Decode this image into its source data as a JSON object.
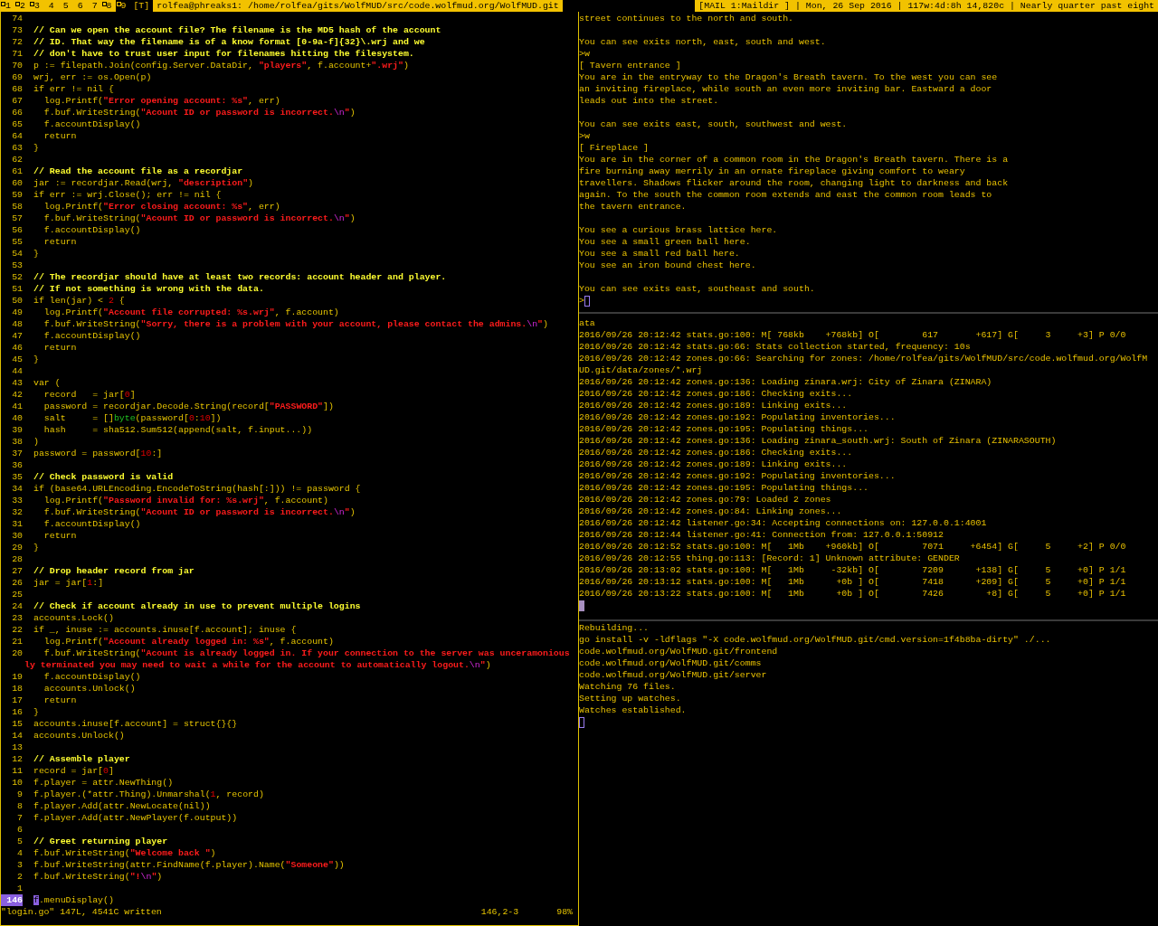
{
  "bar": {
    "tags": [
      {
        "label": "1",
        "occupied": true,
        "selected": false
      },
      {
        "label": "2",
        "occupied": true,
        "selected": false
      },
      {
        "label": "3",
        "occupied": true,
        "selected": false
      },
      {
        "label": "4",
        "occupied": false,
        "selected": false
      },
      {
        "label": "5",
        "occupied": false,
        "selected": false
      },
      {
        "label": "6",
        "occupied": false,
        "selected": false
      },
      {
        "label": "7",
        "occupied": false,
        "selected": false
      },
      {
        "label": "8",
        "occupied": true,
        "selected": false
      },
      {
        "label": "9",
        "occupied": true,
        "selected": true
      }
    ],
    "layout": "[T]",
    "title": "rolfea@phreaks1: /home/rolfea/gits/WolfMUD/src/code.wolfmud.org/WolfMUD.git",
    "status": "[MAIL 1:Maildir ] | Mon, 26 Sep 2016 | 117w:4d:8h 14,820c | Nearly quarter past eight"
  },
  "editor": {
    "lines": [
      {
        "number": "74",
        "current": false
      },
      {
        "number": "73",
        "current": false,
        "segments": [
          {
            "kind": "comment",
            "text": "// Can we open the account file? The filename is the MD5 hash of the account"
          }
        ]
      },
      {
        "number": "72",
        "current": false,
        "segments": [
          {
            "kind": "comment",
            "text": "// ID. That way the filename is of a know format [0-9a-f]{32}\\.wrj and we"
          }
        ]
      },
      {
        "number": "71",
        "current": false,
        "segments": [
          {
            "kind": "comment",
            "text": "// don't have to trust user input for filenames hitting the filesystem."
          }
        ]
      },
      {
        "number": "70",
        "current": false,
        "segments": [
          {
            "kind": "code",
            "text": "p := filepath.Join(config.Server.DataDir, "
          },
          {
            "kind": "string",
            "text": "\"players\""
          },
          {
            "kind": "code",
            "text": ", f.account+"
          },
          {
            "kind": "string",
            "text": "\".wrj\""
          },
          {
            "kind": "code",
            "text": ")"
          }
        ]
      },
      {
        "number": "69",
        "current": false,
        "segments": [
          {
            "kind": "code",
            "text": "wrj, err := os.Open(p)"
          }
        ]
      },
      {
        "number": "68",
        "current": false,
        "segments": [
          {
            "kind": "code",
            "text": "if err != nil {"
          }
        ]
      },
      {
        "number": "67",
        "current": false,
        "segments": [
          {
            "kind": "code",
            "text": "  log.Printf("
          },
          {
            "kind": "string",
            "text": "\"Error opening account: %s\""
          },
          {
            "kind": "code",
            "text": ", err)"
          }
        ]
      },
      {
        "number": "66",
        "current": false,
        "segments": [
          {
            "kind": "code",
            "text": "  f.buf.WriteString("
          },
          {
            "kind": "string",
            "text": "\"Acount ID or password is incorrect."
          },
          {
            "kind": "escape",
            "text": "\\n"
          },
          {
            "kind": "string",
            "text": "\""
          },
          {
            "kind": "code",
            "text": ")"
          }
        ]
      },
      {
        "number": "65",
        "current": false,
        "segments": [
          {
            "kind": "code",
            "text": "  f.accountDisplay()"
          }
        ]
      },
      {
        "number": "64",
        "current": false,
        "segments": [
          {
            "kind": "code",
            "text": "  return"
          }
        ]
      },
      {
        "number": "63",
        "current": false,
        "segments": [
          {
            "kind": "code",
            "text": "}"
          }
        ]
      },
      {
        "number": "62",
        "current": false
      },
      {
        "number": "61",
        "current": false,
        "segments": [
          {
            "kind": "comment",
            "text": "// Read the account file as a recordjar"
          }
        ]
      },
      {
        "number": "60",
        "current": false,
        "segments": [
          {
            "kind": "code",
            "text": "jar := recordjar.Read(wrj, "
          },
          {
            "kind": "string",
            "text": "\"description\""
          },
          {
            "kind": "code",
            "text": ")"
          }
        ]
      },
      {
        "number": "59",
        "current": false,
        "segments": [
          {
            "kind": "code",
            "text": "if err := wrj.Close(); err != nil {"
          }
        ]
      },
      {
        "number": "58",
        "current": false,
        "segments": [
          {
            "kind": "code",
            "text": "  log.Printf("
          },
          {
            "kind": "string",
            "text": "\"Error closing account: %s\""
          },
          {
            "kind": "code",
            "text": ", err)"
          }
        ]
      },
      {
        "number": "57",
        "current": false,
        "segments": [
          {
            "kind": "code",
            "text": "  f.buf.WriteString("
          },
          {
            "kind": "string",
            "text": "\"Acount ID or password is incorrect."
          },
          {
            "kind": "escape",
            "text": "\\n"
          },
          {
            "kind": "string",
            "text": "\""
          },
          {
            "kind": "code",
            "text": ")"
          }
        ]
      },
      {
        "number": "56",
        "current": false,
        "segments": [
          {
            "kind": "code",
            "text": "  f.accountDisplay()"
          }
        ]
      },
      {
        "number": "55",
        "current": false,
        "segments": [
          {
            "kind": "code",
            "text": "  return"
          }
        ]
      },
      {
        "number": "54",
        "current": false,
        "segments": [
          {
            "kind": "code",
            "text": "}"
          }
        ]
      },
      {
        "number": "53",
        "current": false
      },
      {
        "number": "52",
        "current": false,
        "segments": [
          {
            "kind": "comment",
            "text": "// The recordjar should have at least two records: account header and player."
          }
        ]
      },
      {
        "number": "51",
        "current": false,
        "segments": [
          {
            "kind": "comment",
            "text": "// If not something is wrong with the data."
          }
        ]
      },
      {
        "number": "50",
        "current": false,
        "segments": [
          {
            "kind": "code",
            "text": "if len(jar) < "
          },
          {
            "kind": "number",
            "text": "2"
          },
          {
            "kind": "code",
            "text": " {"
          }
        ]
      },
      {
        "number": "49",
        "current": false,
        "segments": [
          {
            "kind": "code",
            "text": "  log.Printf("
          },
          {
            "kind": "string",
            "text": "\"Account file corrupted: %s.wrj\""
          },
          {
            "kind": "code",
            "text": ", f.account)"
          }
        ]
      },
      {
        "number": "48",
        "current": false,
        "segments": [
          {
            "kind": "code",
            "text": "  f.buf.WriteString("
          },
          {
            "kind": "string",
            "text": "\"Sorry, there is a problem with your account, please contact the admins."
          },
          {
            "kind": "escape",
            "text": "\\n"
          },
          {
            "kind": "string",
            "text": "\""
          },
          {
            "kind": "code",
            "text": ")"
          }
        ]
      },
      {
        "number": "47",
        "current": false,
        "segments": [
          {
            "kind": "code",
            "text": "  f.accountDisplay()"
          }
        ]
      },
      {
        "number": "46",
        "current": false,
        "segments": [
          {
            "kind": "code",
            "text": "  return"
          }
        ]
      },
      {
        "number": "45",
        "current": false,
        "segments": [
          {
            "kind": "code",
            "text": "}"
          }
        ]
      },
      {
        "number": "44",
        "current": false
      },
      {
        "number": "43",
        "current": false,
        "segments": [
          {
            "kind": "code",
            "text": "var ("
          }
        ]
      },
      {
        "number": "42",
        "current": false,
        "segments": [
          {
            "kind": "code",
            "text": "  record   = jar["
          },
          {
            "kind": "number",
            "text": "0"
          },
          {
            "kind": "code",
            "text": "]"
          }
        ]
      },
      {
        "number": "41",
        "current": false,
        "segments": [
          {
            "kind": "code",
            "text": "  password = recordjar.Decode.String(record["
          },
          {
            "kind": "string",
            "text": "\"PASSWORD\""
          },
          {
            "kind": "code",
            "text": "])"
          }
        ]
      },
      {
        "number": "40",
        "current": false,
        "segments": [
          {
            "kind": "code",
            "text": "  salt     = []"
          },
          {
            "kind": "type",
            "text": "byte"
          },
          {
            "kind": "code",
            "text": "(password["
          },
          {
            "kind": "number",
            "text": "0"
          },
          {
            "kind": "code",
            "text": ":"
          },
          {
            "kind": "number",
            "text": "10"
          },
          {
            "kind": "code",
            "text": "])"
          }
        ]
      },
      {
        "number": "39",
        "current": false,
        "segments": [
          {
            "kind": "code",
            "text": "  hash     = sha512.Sum512(append(salt, f.input...))"
          }
        ]
      },
      {
        "number": "38",
        "current": false,
        "segments": [
          {
            "kind": "code",
            "text": ")"
          }
        ]
      },
      {
        "number": "37",
        "current": false,
        "segments": [
          {
            "kind": "code",
            "text": "password = password["
          },
          {
            "kind": "number",
            "text": "10"
          },
          {
            "kind": "code",
            "text": ":]"
          }
        ]
      },
      {
        "number": "36",
        "current": false
      },
      {
        "number": "35",
        "current": false,
        "segments": [
          {
            "kind": "comment",
            "text": "// Check password is valid"
          }
        ]
      },
      {
        "number": "34",
        "current": false,
        "segments": [
          {
            "kind": "code",
            "text": "if (base64.URLEncoding.EncodeToString(hash[:])) != password {"
          }
        ]
      },
      {
        "number": "33",
        "current": false,
        "segments": [
          {
            "kind": "code",
            "text": "  log.Printf("
          },
          {
            "kind": "string",
            "text": "\"Password invalid for: %s.wrj\""
          },
          {
            "kind": "code",
            "text": ", f.account)"
          }
        ]
      },
      {
        "number": "32",
        "current": false,
        "segments": [
          {
            "kind": "code",
            "text": "  f.buf.WriteString("
          },
          {
            "kind": "string",
            "text": "\"Acount ID or password is incorrect."
          },
          {
            "kind": "escape",
            "text": "\\n"
          },
          {
            "kind": "string",
            "text": "\""
          },
          {
            "kind": "code",
            "text": ")"
          }
        ]
      },
      {
        "number": "31",
        "current": false,
        "segments": [
          {
            "kind": "code",
            "text": "  f.accountDisplay()"
          }
        ]
      },
      {
        "number": "30",
        "current": false,
        "segments": [
          {
            "kind": "code",
            "text": "  return"
          }
        ]
      },
      {
        "number": "29",
        "current": false,
        "segments": [
          {
            "kind": "code",
            "text": "}"
          }
        ]
      },
      {
        "number": "28",
        "current": false
      },
      {
        "number": "27",
        "current": false,
        "segments": [
          {
            "kind": "comment",
            "text": "// Drop header record from jar"
          }
        ]
      },
      {
        "number": "26",
        "current": false,
        "segments": [
          {
            "kind": "code",
            "text": "jar = jar["
          },
          {
            "kind": "number",
            "text": "1"
          },
          {
            "kind": "code",
            "text": ":]"
          }
        ]
      },
      {
        "number": "25",
        "current": false
      },
      {
        "number": "24",
        "current": false,
        "segments": [
          {
            "kind": "comment",
            "text": "// Check if account already in use to prevent multiple logins"
          }
        ]
      },
      {
        "number": "23",
        "current": false,
        "segments": [
          {
            "kind": "code",
            "text": "accounts.Lock()"
          }
        ]
      },
      {
        "number": "22",
        "current": false,
        "segments": [
          {
            "kind": "code",
            "text": "if _, inuse := accounts.inuse[f.account]; inuse {"
          }
        ]
      },
      {
        "number": "21",
        "current": false,
        "segments": [
          {
            "kind": "code",
            "text": "  log.Printf("
          },
          {
            "kind": "string",
            "text": "\"Account already logged in: %s\""
          },
          {
            "kind": "code",
            "text": ", f.account)"
          }
        ]
      },
      {
        "number": "20",
        "current": false,
        "segments": [
          {
            "kind": "code",
            "text": "  f.buf.WriteString("
          },
          {
            "kind": "string",
            "text": "\"Acount is already logged in. If your connection to the server was unceramonious"
          }
        ],
        "continuation": [
          {
            "kind": "string",
            "text": "ly terminated you may need to wait a while for the account to automatically logout."
          },
          {
            "kind": "escape",
            "text": "\\n"
          },
          {
            "kind": "string",
            "text": "\""
          },
          {
            "kind": "code",
            "text": ")"
          }
        ]
      },
      {
        "number": "19",
        "current": false,
        "segments": [
          {
            "kind": "code",
            "text": "  f.accountDisplay()"
          }
        ]
      },
      {
        "number": "18",
        "current": false,
        "segments": [
          {
            "kind": "code",
            "text": "  accounts.Unlock()"
          }
        ]
      },
      {
        "number": "17",
        "current": false,
        "segments": [
          {
            "kind": "code",
            "text": "  return"
          }
        ]
      },
      {
        "number": "16",
        "current": false,
        "segments": [
          {
            "kind": "code",
            "text": "}"
          }
        ]
      },
      {
        "number": "15",
        "current": false,
        "segments": [
          {
            "kind": "code",
            "text": "accounts.inuse[f.account] = struct{}{}"
          }
        ]
      },
      {
        "number": "14",
        "current": false,
        "segments": [
          {
            "kind": "code",
            "text": "accounts.Unlock()"
          }
        ]
      },
      {
        "number": "13",
        "current": false
      },
      {
        "number": "12",
        "current": false,
        "segments": [
          {
            "kind": "comment",
            "text": "// Assemble player"
          }
        ]
      },
      {
        "number": "11",
        "current": false,
        "segments": [
          {
            "kind": "code",
            "text": "record = jar["
          },
          {
            "kind": "number",
            "text": "0"
          },
          {
            "kind": "code",
            "text": "]"
          }
        ]
      },
      {
        "number": "10",
        "current": false,
        "segments": [
          {
            "kind": "code",
            "text": "f.player = attr.NewThing()"
          }
        ]
      },
      {
        "number": "9",
        "current": false,
        "segments": [
          {
            "kind": "code",
            "text": "f.player.(*attr.Thing).Unmarshal("
          },
          {
            "kind": "number",
            "text": "1"
          },
          {
            "kind": "code",
            "text": ", record)"
          }
        ]
      },
      {
        "number": "8",
        "current": false,
        "segments": [
          {
            "kind": "code",
            "text": "f.player.Add(attr.NewLocate(nil))"
          }
        ]
      },
      {
        "number": "7",
        "current": false,
        "segments": [
          {
            "kind": "code",
            "text": "f.player.Add(attr.NewPlayer(f.output))"
          }
        ]
      },
      {
        "number": "6",
        "current": false
      },
      {
        "number": "5",
        "current": false,
        "segments": [
          {
            "kind": "comment",
            "text": "// Greet returning player"
          }
        ]
      },
      {
        "number": "4",
        "current": false,
        "segments": [
          {
            "kind": "code",
            "text": "f.buf.WriteString("
          },
          {
            "kind": "string",
            "text": "\"Welcome back \""
          },
          {
            "kind": "code",
            "text": ")"
          }
        ]
      },
      {
        "number": "3",
        "current": false,
        "segments": [
          {
            "kind": "code",
            "text": "f.buf.WriteString(attr.FindName(f.player).Name("
          },
          {
            "kind": "string",
            "text": "\"Someone\""
          },
          {
            "kind": "code",
            "text": "))"
          }
        ]
      },
      {
        "number": "2",
        "current": false,
        "segments": [
          {
            "kind": "code",
            "text": "f.buf.WriteString("
          },
          {
            "kind": "string",
            "text": "\"!"
          },
          {
            "kind": "escape",
            "text": "\\n"
          },
          {
            "kind": "string",
            "text": "\""
          },
          {
            "kind": "code",
            "text": ")"
          }
        ]
      },
      {
        "number": "1",
        "current": false
      },
      {
        "number": "146",
        "current": true,
        "segments": [
          {
            "kind": "cursor",
            "text": "f"
          },
          {
            "kind": "code",
            "text": ".menuDisplay()"
          }
        ]
      }
    ],
    "status_line": {
      "message": "\"login.go\" 147L, 4541C written",
      "position": "146,2-3",
      "scroll": "98%"
    }
  },
  "terminals": [
    {
      "paragraphs": [
        [
          "street continues to the north and south."
        ],
        [
          "You can see exits north, east, south and west.",
          ">w",
          "[ Tavern entrance ]",
          "You are in the entryway to the Dragon's Breath tavern. To the west you can see",
          "an inviting fireplace, while south an even more inviting bar. Eastward a door",
          "leads out into the street."
        ],
        [
          "You can see exits east, south, southwest and west.",
          ">w",
          "[ Fireplace ]",
          "You are in the corner of a common room in the Dragon's Breath tavern. There is a",
          "fire burning away merrily in an ornate fireplace giving comfort to weary",
          "travellers. Shadows flicker around the room, changing light to darkness and back",
          "again. To the south the common room extends and east the common room leads to",
          "the tavern entrance."
        ],
        [
          "You see a curious brass lattice here.",
          "You see a small green ball here.",
          "You see a small red ball here.",
          "You see an iron bound chest here."
        ],
        [
          "You can see exits east, southeast and south."
        ]
      ],
      "cursor": {
        "prompt": ">",
        "kind": "outline"
      }
    },
    {
      "paragraphs": [
        [
          "ata",
          "2016/09/26 20:12:42 stats.go:100: M[ 768kb    +768kb] O[        617       +617] G[     3     +3] P 0/0",
          "2016/09/26 20:12:42 stats.go:66: Stats collection started, frequency: 10s",
          "2016/09/26 20:12:42 zones.go:66: Searching for zones: /home/rolfea/gits/WolfMUD/src/code.wolfmud.org/WolfM",
          "UD.git/data/zones/*.wrj",
          "2016/09/26 20:12:42 zones.go:136: Loading zinara.wrj: City of Zinara (ZINARA)",
          "2016/09/26 20:12:42 zones.go:186: Checking exits...",
          "2016/09/26 20:12:42 zones.go:189: Linking exits...",
          "2016/09/26 20:12:42 zones.go:192: Populating inventories...",
          "2016/09/26 20:12:42 zones.go:195: Populating things...",
          "2016/09/26 20:12:42 zones.go:136: Loading zinara_south.wrj: South of Zinara (ZINARASOUTH)",
          "2016/09/26 20:12:42 zones.go:186: Checking exits...",
          "2016/09/26 20:12:42 zones.go:189: Linking exits...",
          "2016/09/26 20:12:42 zones.go:192: Populating inventories...",
          "2016/09/26 20:12:42 zones.go:195: Populating things...",
          "2016/09/26 20:12:42 zones.go:79: Loaded 2 zones",
          "2016/09/26 20:12:42 zones.go:84: Linking zones...",
          "2016/09/26 20:12:42 listener.go:34: Accepting connections on: 127.0.0.1:4001",
          "2016/09/26 20:12:44 listener.go:41: Connection from: 127.0.0.1:50912",
          "2016/09/26 20:12:52 stats.go:100: M[   1Mb    +960kb] O[        7071     +6454] G[     5     +2] P 0/0",
          "2016/09/26 20:12:55 thing.go:113: [Record: 1] Unknown attribute: GENDER",
          "2016/09/26 20:13:02 stats.go:100: M[   1Mb     -32kb] O[        7209      +138] G[     5     +0] P 1/1",
          "2016/09/26 20:13:12 stats.go:100: M[   1Mb      +0b ] O[        7418      +209] G[     5     +0] P 1/1",
          "2016/09/26 20:13:22 stats.go:100: M[   1Mb      +0b ] O[        7426        +8] G[     5     +0] P 1/1"
        ]
      ],
      "cursor": {
        "kind": "filled"
      }
    },
    {
      "paragraphs": [
        [
          "Rebuilding...",
          "go install -v -ldflags \"-X code.wolfmud.org/WolfMUD.git/cmd.version=1f4b8ba-dirty\" ./...",
          "code.wolfmud.org/WolfMUD.git/frontend",
          "code.wolfmud.org/WolfMUD.git/comms",
          "code.wolfmud.org/WolfMUD.git/server",
          "Watching 76 files.",
          "Setting up watches.",
          "Watches established."
        ]
      ],
      "cursor": {
        "kind": "outline"
      }
    }
  ]
}
